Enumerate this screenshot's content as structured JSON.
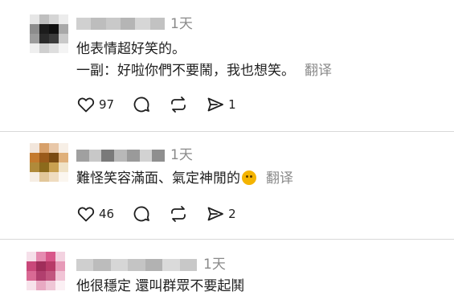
{
  "comments": [
    {
      "time": "1天",
      "lines": [
        "他表情超好笑的。",
        "一副：好啦你們不要鬧，我也想笑。"
      ],
      "translate_label": "翻译",
      "likes": "97",
      "shares": "1",
      "avatar_colors": [
        "#e6e6e6",
        "#bfbfbf",
        "#d5d5d5",
        "#ececec",
        "#8c8c8c",
        "#1c1c1c",
        "#0f0f0f",
        "#a8a8a8",
        "#9c9c9c",
        "#2a2a2a",
        "#3b3b3b",
        "#c9c9c9",
        "#efefef",
        "#cfcfcf",
        "#dedede",
        "#f4f4f4"
      ],
      "name_colors": [
        "#d0d0d0",
        "#bdbdbd",
        "#c9c9c9",
        "#b5b5b5",
        "#d6d6d6",
        "#c2c2c2"
      ]
    },
    {
      "time": "1天",
      "lines": [
        "難怪笑容滿面、氣定神閒的"
      ],
      "translate_label": "翻译",
      "likes": "46",
      "shares": "2",
      "avatar_colors": [
        "#f2e6dc",
        "#d7a06a",
        "#e8c7a8",
        "#f7efe6",
        "#c47a2d",
        "#9a5a1a",
        "#7a4a12",
        "#e0b07a",
        "#b08a3a",
        "#8c6a1c",
        "#c9a050",
        "#f0e2c6",
        "#f6eee4",
        "#e2c79a",
        "#efdcc0",
        "#fbf6ef"
      ],
      "name_colors": [
        "#a0a0a0",
        "#c8c8c8",
        "#7a7a7a",
        "#b8b8b8",
        "#9a9a9a",
        "#d2d2d2",
        "#8f8f8f"
      ]
    },
    {
      "time": "1天",
      "lines": [
        "他很穩定 還叫群眾不要起鬨"
      ],
      "avatar_colors": [
        "#f6e0ea",
        "#e58bb0",
        "#d8578a",
        "#f3d2e0",
        "#c9487a",
        "#a02d5a",
        "#b83a68",
        "#e79ab8",
        "#d96a94",
        "#b13f6e",
        "#c2557f",
        "#f1c4d6",
        "#f7e3eb",
        "#e8a9c2",
        "#efc6d6",
        "#fbf0f4"
      ],
      "name_colors": [
        "#cfcfcf",
        "#bcbcbc",
        "#d6d6d6",
        "#c4c4c4",
        "#b2b2b2",
        "#dadada",
        "#c8c8c8"
      ]
    }
  ]
}
